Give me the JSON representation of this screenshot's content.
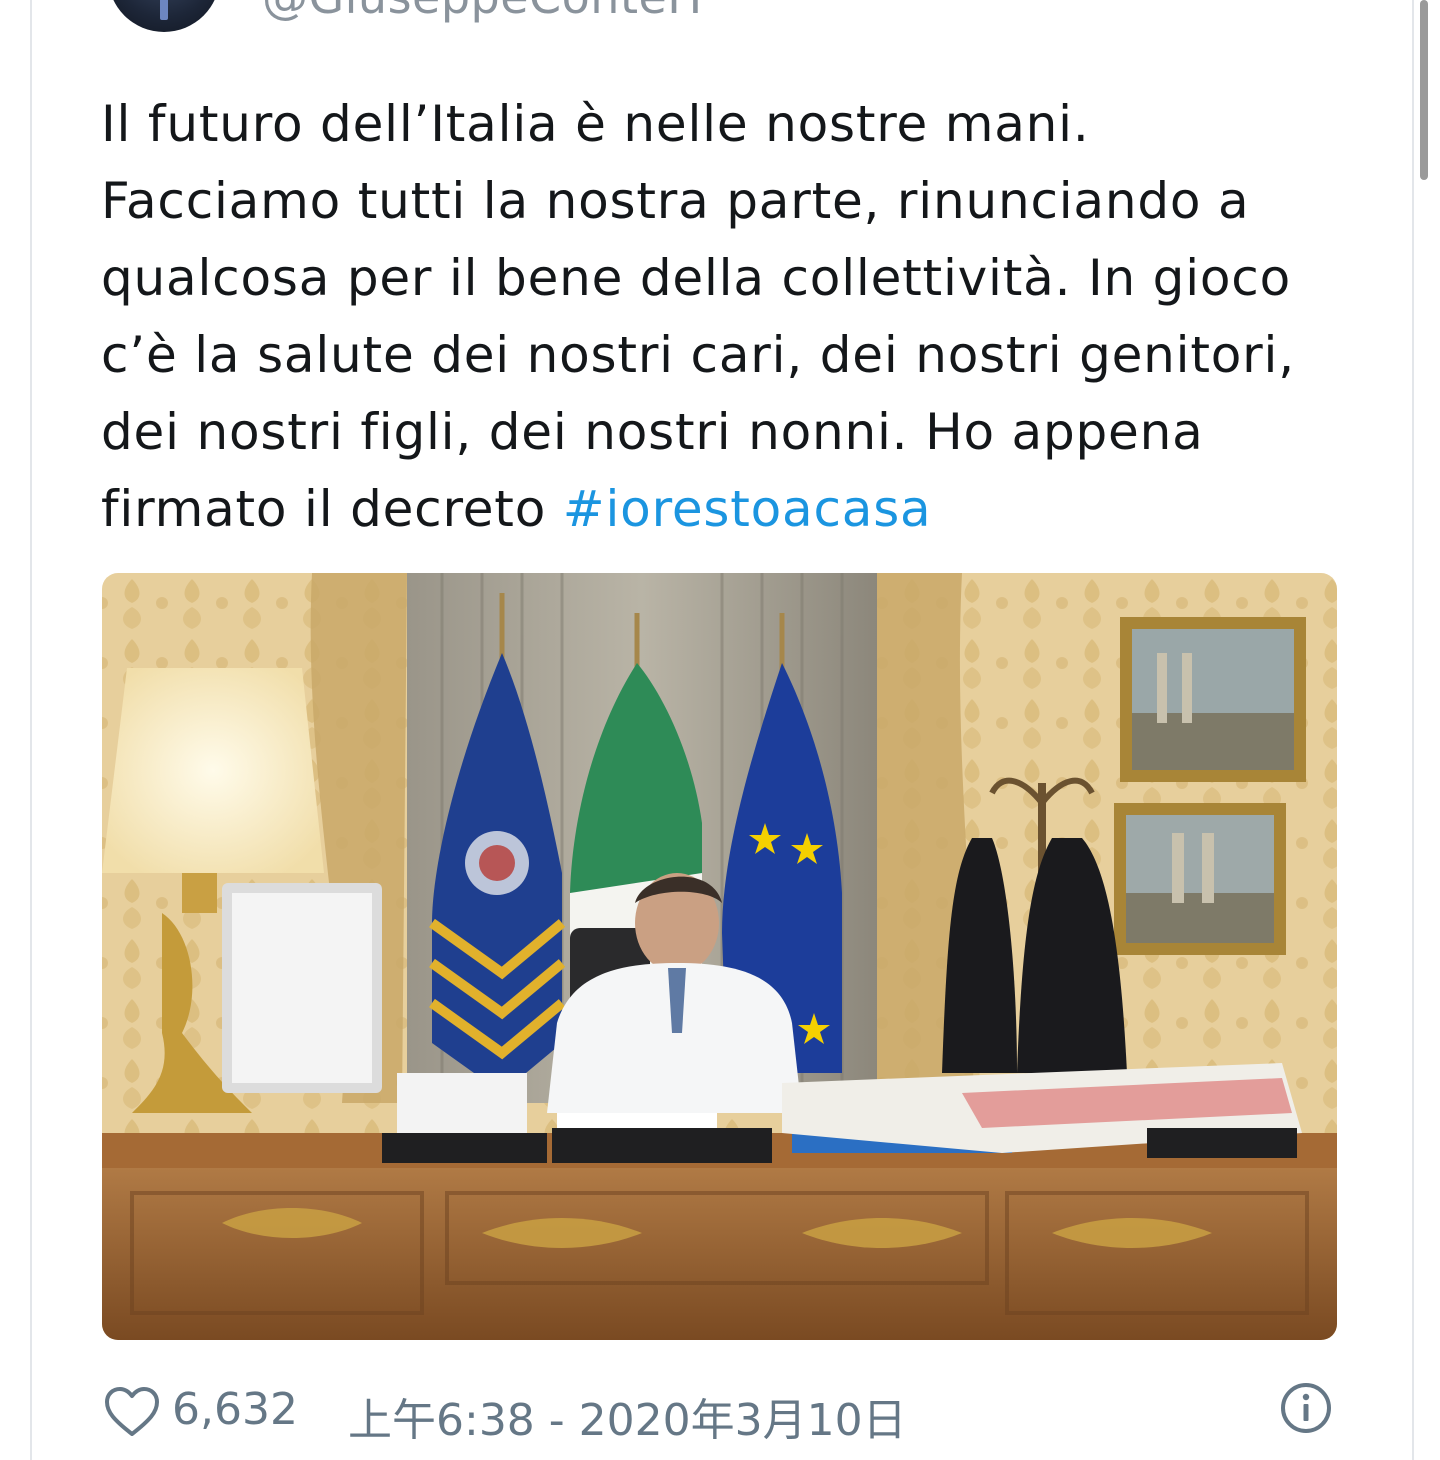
{
  "tweet": {
    "handle": "@GiuseppeConteIT",
    "text": "Il futuro dell’Italia è nelle nostre mani.\nFacciamo tutti la nostra parte, rinunciando a\nqualcosa per il bene della collettività. In gioco\nc’è la salute dei nostri cari, dei nostri genitori,\ndei nostri figli, dei nostri nonni. Ho appena\nfirmato il decreto ",
    "hashtag": "#iorestoacasa",
    "likes": "6,632",
    "timestamp": "上午6:38 - 2020年3月10日"
  },
  "icons": {
    "like": "heart-icon",
    "info": "info-icon"
  },
  "colors": {
    "text": "#14171a",
    "link": "#1b95e0",
    "meta": "#657786"
  }
}
